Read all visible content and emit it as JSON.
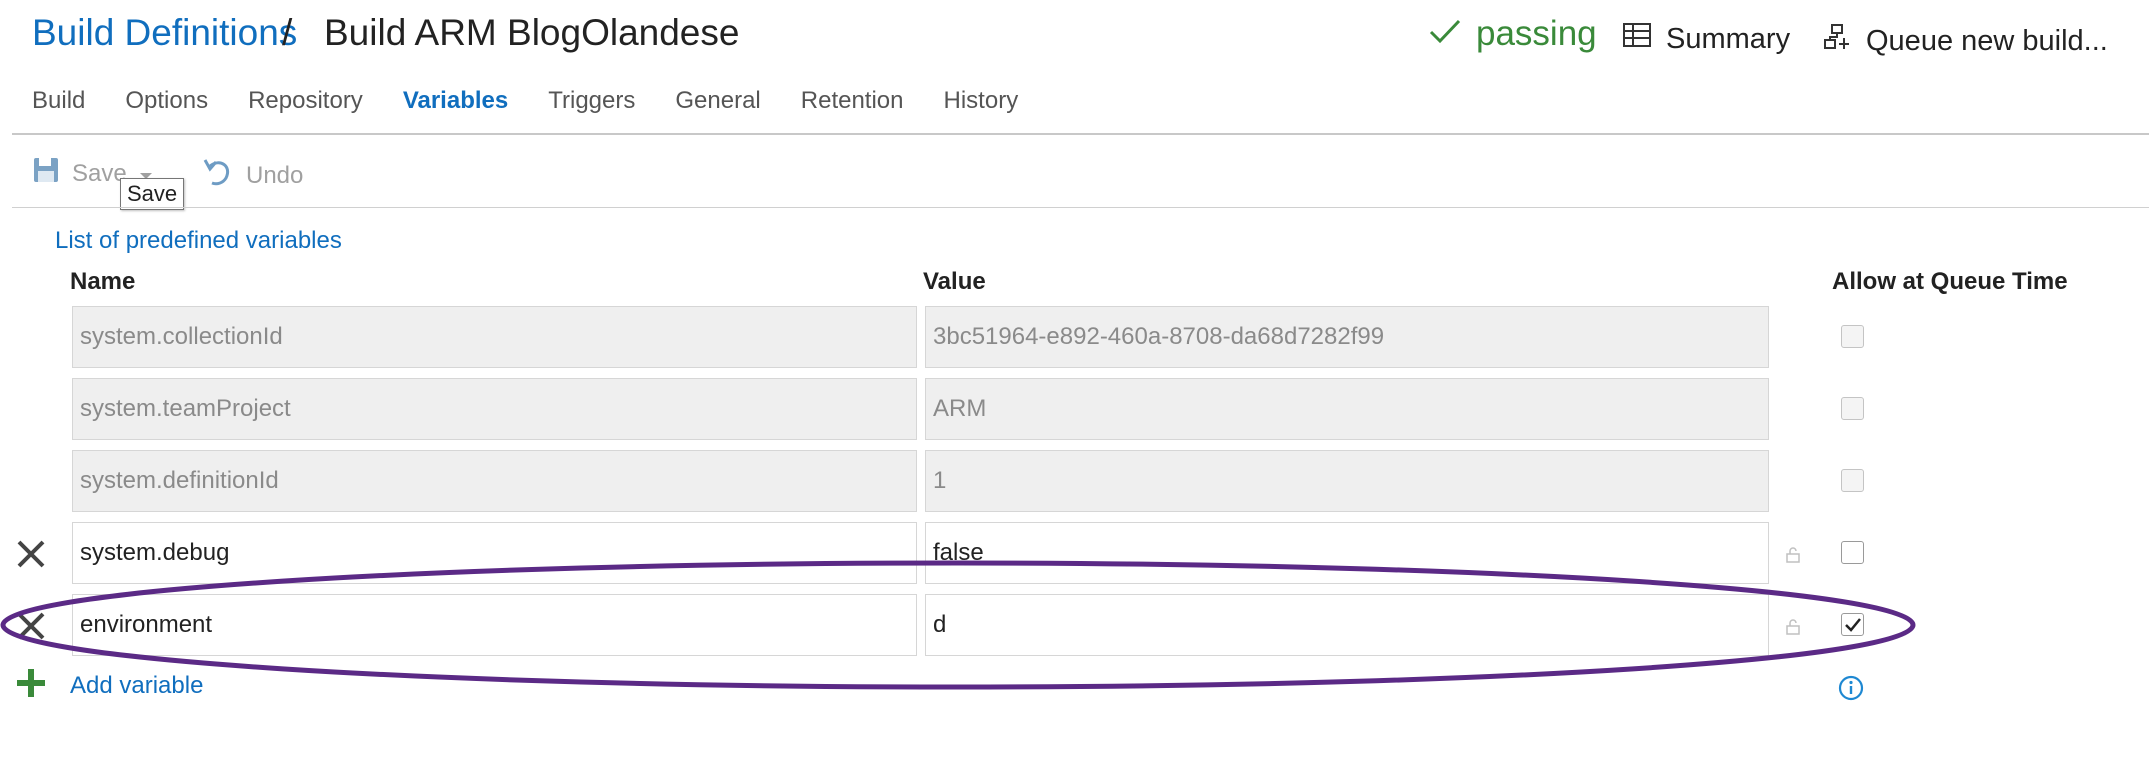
{
  "header": {
    "breadcrumb_link": "Build Definitions",
    "breadcrumb_separator": "/",
    "title": "Build ARM BlogOlandese",
    "status": "passing",
    "summary_label": "Summary",
    "queue_label": "Queue new build..."
  },
  "tabs": [
    {
      "label": "Build"
    },
    {
      "label": "Options"
    },
    {
      "label": "Repository"
    },
    {
      "label": "Variables",
      "active": true
    },
    {
      "label": "Triggers"
    },
    {
      "label": "General"
    },
    {
      "label": "Retention"
    },
    {
      "label": "History"
    }
  ],
  "toolbar": {
    "save_label": "Save",
    "undo_label": "Undo",
    "tooltip": "Save"
  },
  "content": {
    "predefined_link": "List of predefined variables",
    "col_name": "Name",
    "col_value": "Value",
    "col_queue": "Allow at Queue Time",
    "add_label": "Add variable"
  },
  "variables": [
    {
      "name": "system.collectionId",
      "value": "3bc51964-e892-460a-8708-da68d7282f99",
      "readonly": true,
      "queue_time": false
    },
    {
      "name": "system.teamProject",
      "value": "ARM",
      "readonly": true,
      "queue_time": false
    },
    {
      "name": "system.definitionId",
      "value": "1",
      "readonly": true,
      "queue_time": false
    },
    {
      "name": "system.debug",
      "value": "false",
      "readonly": false,
      "queue_time": false
    },
    {
      "name": "environment",
      "value": "d",
      "readonly": false,
      "queue_time": true
    }
  ],
  "colors": {
    "link": "#106ebe",
    "passing": "#3a8a3a",
    "highlight_ellipse": "#5b2a86",
    "add_icon": "#3a8a3a"
  }
}
